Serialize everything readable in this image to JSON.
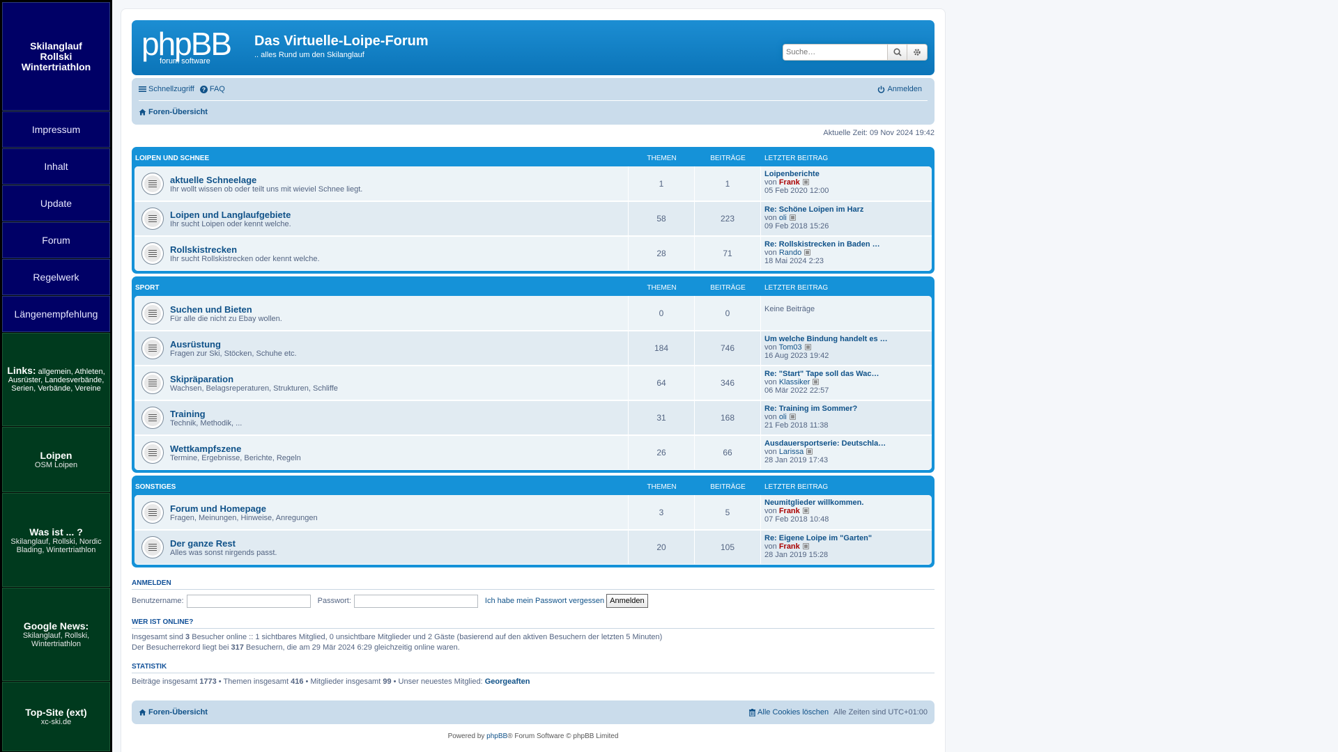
{
  "sidebar": {
    "logo_lines": [
      "Skilanglauf",
      "Rollski",
      "Wintertriathlon"
    ],
    "nav": [
      "Impressum",
      "Inhalt",
      "Update",
      "Forum",
      "Regelwerk",
      "Längenempfehlung"
    ],
    "links": {
      "title": "Links:",
      "text": "allgemein, Athleten, Ausrüster, Landesverbände, Serien, Verbände, Vereine"
    },
    "loipen": {
      "title": "Loipen",
      "sub": "OSM Loipen"
    },
    "was": {
      "title": "Was ist ... ?",
      "sub": "Skilanglauf, Rollski, Nordic Blading, Wintertriathlon"
    },
    "gnews": {
      "title": "Google News:",
      "sub": "Skilanglauf, Rollski, Wintertriathlon"
    },
    "top": {
      "title": "Top-Site (ext)",
      "sub": "xc-ski.de"
    }
  },
  "header": {
    "logo_text": "phpBB",
    "logo_sub": "forum software",
    "site_title": "Das Virtuelle-Loipe-Forum",
    "site_desc": ".. alles Rund um den Skilanglauf",
    "search_placeholder": "Suche…"
  },
  "navbar": {
    "quicklinks": "Schnellzugriff",
    "faq": "FAQ",
    "login": "Anmelden",
    "breadcrumb": "Foren-Übersicht"
  },
  "current_time": "Aktuelle Zeit: 09 Nov 2024 19:42",
  "col_topics": "Themen",
  "col_posts": "Beiträge",
  "col_last": "Letzter Beitrag",
  "by": "von",
  "categories": [
    {
      "title": "Loipen und Schnee",
      "forums": [
        {
          "title": "aktuelle Schneelage",
          "desc": "Ihr wollt wissen ob oder teilt uns mit wieviel Schnee liegt.",
          "topics": "1",
          "posts": "1",
          "last_title": "Loipenberichte",
          "last_author": "Frank",
          "red": true,
          "last_time": "05 Feb 2020 12:00"
        },
        {
          "title": "Loipen und Langlaufgebiete",
          "desc": "Ihr sucht Loipen oder kennt welche.",
          "topics": "58",
          "posts": "223",
          "last_title": "Re: Schöne Loipen im Harz",
          "last_author": "oli",
          "red": false,
          "last_time": "09 Feb 2018 15:26"
        },
        {
          "title": "Rollskistrecken",
          "desc": "Ihr sucht Rollskistrecken oder kennt welche.",
          "topics": "28",
          "posts": "71",
          "last_title": "Re: Rollskistrecken in Baden …",
          "last_author": "Rando",
          "red": false,
          "last_time": "18 Mai 2024 2:23"
        }
      ]
    },
    {
      "title": "Sport",
      "forums": [
        {
          "title": "Suchen und Bieten",
          "desc": "Für alle die nicht zu Ebay wollen.",
          "topics": "0",
          "posts": "0",
          "nopost": "Keine Beiträge"
        },
        {
          "title": "Ausrüstung",
          "desc": "Fragen zur Ski, Stöcken, Schuhe etc.",
          "topics": "184",
          "posts": "746",
          "last_title": "Um welche Bindung handelt es …",
          "last_author": "Tom03",
          "red": false,
          "last_time": "16 Aug 2023 19:42"
        },
        {
          "title": "Skipräparation",
          "desc": "Wachsen, Belagsreperaturen, Strukturen, Schliffe",
          "topics": "64",
          "posts": "346",
          "last_title": "Re: \"Start\" Tape soll das Wac…",
          "last_author": "Klassiker",
          "red": false,
          "last_time": "06 Mär 2022 22:57"
        },
        {
          "title": "Training",
          "desc": "Technik, Methodik, ...",
          "topics": "31",
          "posts": "168",
          "last_title": "Re: Training im Sommer?",
          "last_author": "oli",
          "red": false,
          "last_time": "21 Feb 2018 11:38"
        },
        {
          "title": "Wettkampfszene",
          "desc": "Termine, Ergebnisse, Berichte, Regeln",
          "topics": "26",
          "posts": "66",
          "last_title": "Ausdauersportserie: Deutschla…",
          "last_author": "Larissa",
          "red": false,
          "last_time": "28 Jan 2019 17:43"
        }
      ]
    },
    {
      "title": "Sonstiges",
      "forums": [
        {
          "title": "Forum und Homepage",
          "desc": "Fragen, Meinungen, Hinweise, Anregungen",
          "topics": "3",
          "posts": "5",
          "last_title": "Neumitglieder willkommen.",
          "last_author": "Frank",
          "red": true,
          "last_time": "07 Feb 2018 10:48"
        },
        {
          "title": "Der ganze Rest",
          "desc": "Alles was sonst nirgends passt.",
          "topics": "20",
          "posts": "105",
          "last_title": "Re: Eigene Loipe im \"Garten\"",
          "last_author": "Frank",
          "red": true,
          "last_time": "28 Jan 2019 15:28"
        }
      ]
    }
  ],
  "login": {
    "heading": "Anmelden",
    "username_label": "Benutzername:",
    "password_label": "Passwort:",
    "forgot": "Ich habe mein Passwort vergessen",
    "button": "Anmelden"
  },
  "online": {
    "heading": "Wer ist online?",
    "line1_a": "Insgesamt sind ",
    "line1_n": "3",
    "line1_b": " Besucher online :: 1 sichtbares Mitglied, 0 unsichtbare Mitglieder und 2 Gäste (basierend auf den aktiven Besuchern der letzten 5 Minuten)",
    "line2_a": "Der Besucherrekord liegt bei ",
    "line2_n": "317",
    "line2_b": " Besuchern, die am 29 Mär 2024 6:29 gleichzeitig online waren."
  },
  "stats": {
    "heading": "Statistik",
    "posts_label": "Beiträge insgesamt ",
    "posts": "1773",
    "topics_label": " • Themen insgesamt ",
    "topics": "416",
    "members_label": " • Mitglieder insgesamt ",
    "members": "99",
    "newest_label": " • Unser neuestes Mitglied: ",
    "newest": "Georgeaften"
  },
  "footer": {
    "breadcrumb": "Foren-Übersicht",
    "cookies": "Alle Cookies löschen",
    "timezone": "Alle Zeiten sind UTC+01:00",
    "powered_a": "Powered by ",
    "powered_link": "phpBB",
    "powered_b": "® Forum Software © phpBB Limited"
  }
}
